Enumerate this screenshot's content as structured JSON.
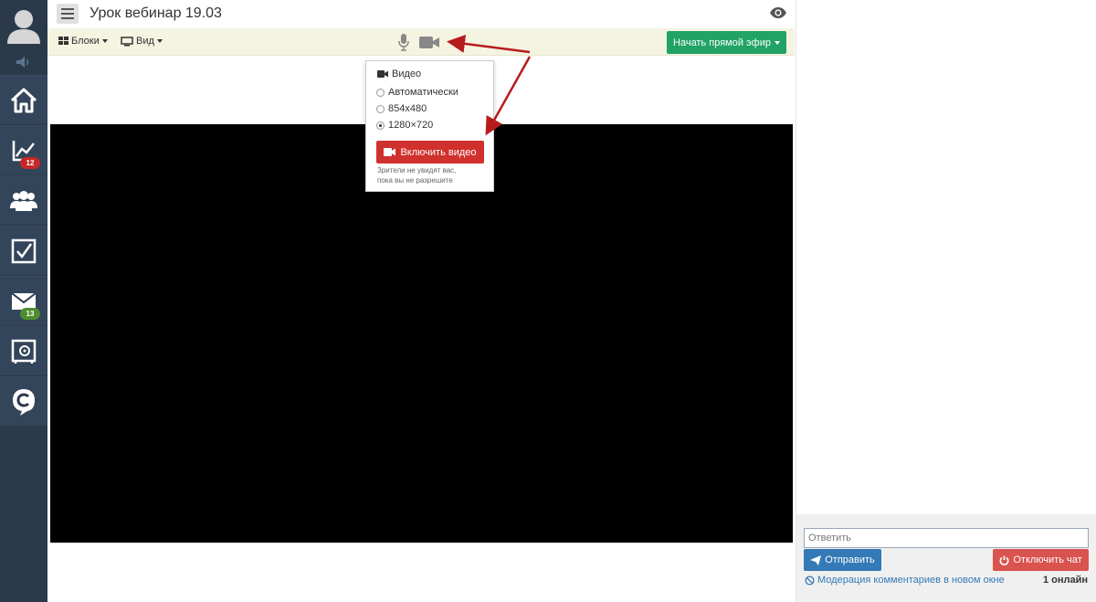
{
  "header": {
    "title": "Урок вебинар 19.03",
    "eye_icon": "eye-icon"
  },
  "toolbar": {
    "blocks_label": "Блоки",
    "view_label": "Вид",
    "live_label": "Начать прямой эфир",
    "icons": [
      "grid-icon",
      "monitor-icon",
      "microphone-icon",
      "camera-icon"
    ],
    "live_color": "#21a366"
  },
  "sidebar": {
    "items": [
      {
        "icon": "home-icon"
      },
      {
        "icon": "chart-icon",
        "badge": "12"
      },
      {
        "icon": "users-icon"
      },
      {
        "icon": "checkbox-icon"
      },
      {
        "icon": "mail-icon",
        "badge": "13"
      },
      {
        "icon": "safe-icon"
      },
      {
        "icon": "chat-logo-icon"
      }
    ],
    "bg_color": "#2b3a4b"
  },
  "video_popup": {
    "heading": "Видео",
    "options": [
      {
        "label": "Автоматически",
        "selected": false
      },
      {
        "label": "854x480",
        "selected": false
      },
      {
        "label": "1280×720",
        "selected": true
      }
    ],
    "enable_button": "Включить видео",
    "note_line1": "Зрители не увидят вас,",
    "note_line2": "пока вы не разрешите",
    "button_color": "#d0312d"
  },
  "chat": {
    "reply_placeholder": "Ответить",
    "send_button": "Отправить",
    "disable_button": "Отключить чат",
    "moderation_link": "Модерация комментариев в новом окне",
    "online_count": "1 онлайн"
  },
  "annotation": {
    "arrow_color": "#b71c1c"
  }
}
